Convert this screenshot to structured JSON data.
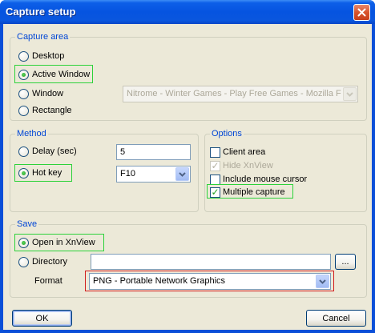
{
  "window": {
    "title": "Capture setup"
  },
  "capture_area": {
    "legend": "Capture area",
    "desktop": "Desktop",
    "active_window": "Active Window",
    "window": "Window",
    "rectangle": "Rectangle",
    "window_select_value": "Nitrome - Winter Games - Play Free Games - Mozilla Firefox"
  },
  "method": {
    "legend": "Method",
    "delay_label": "Delay (sec)",
    "delay_value": "5",
    "hotkey_label": "Hot key",
    "hotkey_value": "F10"
  },
  "options": {
    "legend": "Options",
    "client_area": "Client area",
    "hide_xnview": "Hide XnView",
    "include_cursor": "Include mouse cursor",
    "multiple_capture": "Multiple capture"
  },
  "save": {
    "legend": "Save",
    "open_in_xnview": "Open in XnView",
    "directory": "Directory",
    "directory_value": "",
    "browse_label": "...",
    "format_label": "Format",
    "format_value": "PNG - Portable Network Graphics"
  },
  "buttons": {
    "ok": "OK",
    "cancel": "Cancel"
  },
  "colors": {
    "titlebar": "#0654e0",
    "dialog_bg": "#ece9d8",
    "group_legend": "#0046d5",
    "highlight_green": "#2dd23a",
    "highlight_red": "#d11b1b"
  }
}
